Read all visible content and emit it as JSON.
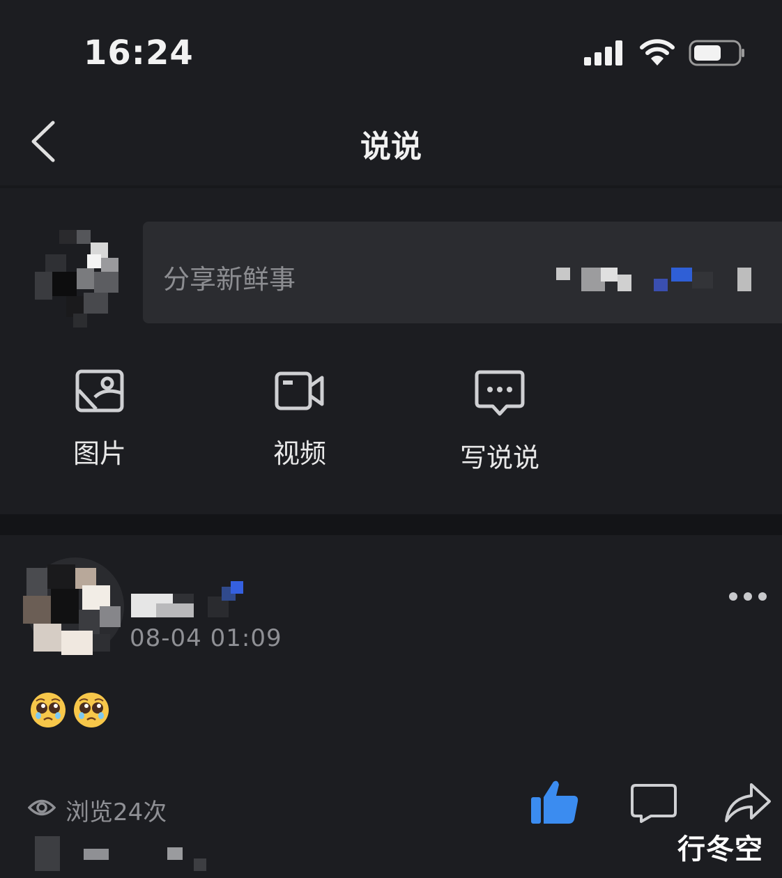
{
  "status_bar": {
    "time": "16:24",
    "signal_icon": "cellular-signal-icon",
    "wifi_icon": "wifi-icon",
    "battery_icon": "battery-icon"
  },
  "nav": {
    "back_icon": "chevron-left-icon",
    "title": "说说"
  },
  "composer": {
    "placeholder": "分享新鲜事",
    "actions": [
      {
        "label": "图片",
        "icon": "image-icon"
      },
      {
        "label": "视频",
        "icon": "video-camera-icon"
      },
      {
        "label": "写说说",
        "icon": "message-bubble-icon"
      }
    ]
  },
  "post": {
    "timestamp": "08-04 01:09",
    "content_emojis": [
      "pleading-face-emoji",
      "pleading-face-emoji"
    ],
    "more_icon": "more-dots-icon",
    "views_text": "浏览24次",
    "actions": {
      "like_icon": "thumbs-up-icon",
      "comment_icon": "comment-icon",
      "share_icon": "share-arrow-icon"
    }
  },
  "watermark": "行冬空",
  "colors": {
    "background": "#1c1d21",
    "card": "#2b2c30",
    "like_accent": "#3b8cf0",
    "muted_text": "#8f9095"
  }
}
